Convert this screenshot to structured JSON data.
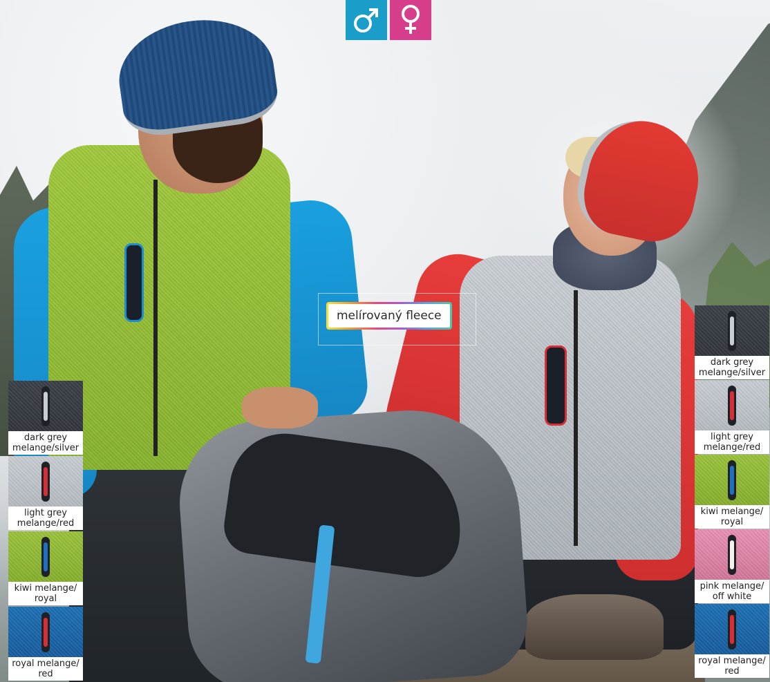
{
  "badge": {
    "male_symbol": "male-symbol-icon",
    "female_symbol": "female-symbol-icon",
    "male_color": "#1a9ec9",
    "female_color": "#d63e8c"
  },
  "feature_label": "melírovaný fleece",
  "swatches_left": [
    {
      "caption": "dark grey\nmelange/silver",
      "fabric": "#343941",
      "zip": "#c9ccd0"
    },
    {
      "caption": "light grey\nmelange/red",
      "fabric": "#bcc3c8",
      "zip": "#d62f37"
    },
    {
      "caption": "kiwi melange/\nroyal",
      "fabric": "#8fb832",
      "zip": "#1f6fc2"
    },
    {
      "caption": "royal melange/\nred",
      "fabric": "#1863a6",
      "zip": "#d62f37"
    }
  ],
  "swatches_right": [
    {
      "caption": "dark grey\nmelange/silver",
      "fabric": "#343941",
      "zip": "#c9ccd0"
    },
    {
      "caption": "light grey\nmelange/red",
      "fabric": "#bcc3c8",
      "zip": "#d62f37"
    },
    {
      "caption": "kiwi melange/\nroyal",
      "fabric": "#8fb832",
      "zip": "#1f6fc2"
    },
    {
      "caption": "pink melange/\noff white",
      "fabric": "#de83a8",
      "zip": "#f4f1ea"
    },
    {
      "caption": "royal melange/\nred",
      "fabric": "#1863a6",
      "zip": "#d62f37"
    }
  ]
}
